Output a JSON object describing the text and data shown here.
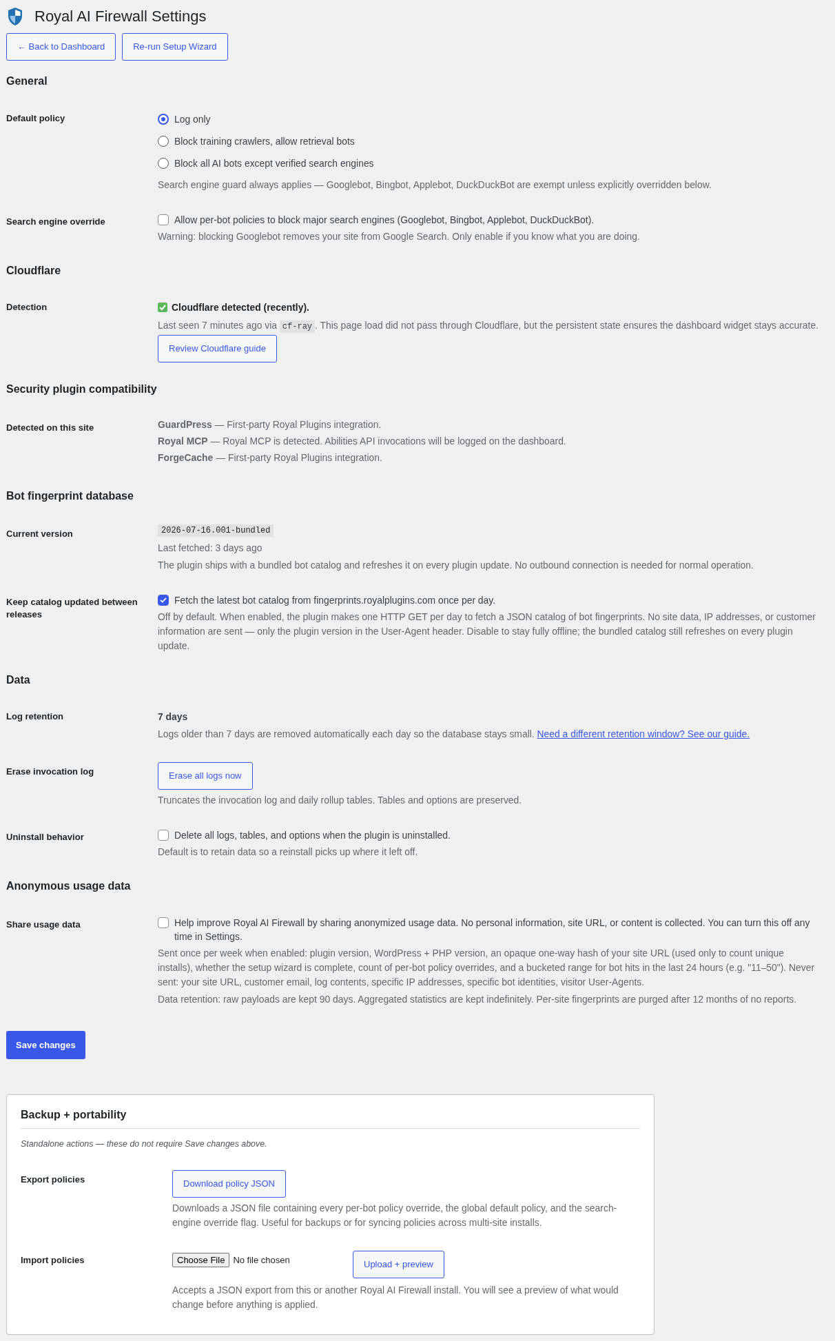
{
  "header": {
    "title": "Royal AI Firewall Settings",
    "buttons": [
      "← Back to Dashboard",
      "Re-run Setup Wizard"
    ]
  },
  "sections": [
    {
      "heading": "General",
      "rows": [
        {
          "kind": "radios",
          "label": "Default policy",
          "options": [
            {
              "label": "Log only",
              "selected": true
            },
            {
              "label": "Block training crawlers, allow retrieval bots",
              "selected": false
            },
            {
              "label": "Block all AI bots except verified search engines",
              "selected": false
            }
          ],
          "notes": [
            "Search engine guard always applies — Googlebot, Bingbot, Applebot, DuckDuckBot are exempt unless explicitly overridden below."
          ]
        },
        {
          "kind": "checkbox",
          "label": "Search engine override",
          "checkbox": {
            "label": "Allow per-bot policies to block major search engines (Googlebot, Bingbot, Applebot, DuckDuckBot).",
            "checked": false
          },
          "notes": [
            "Warning: blocking Googlebot removes your site from Google Search. Only enable if you know what you are doing."
          ]
        }
      ]
    },
    {
      "heading": "Cloudflare",
      "rows": [
        {
          "kind": "status",
          "label": "Detection",
          "status": {
            "text": "Cloudflare detected (recently).",
            "ok": true
          },
          "detail": {
            "before": "Last seen 7 minutes ago via",
            "code": "cf-ray",
            "after": ". This page load did not pass through Cloudflare, but the persistent state ensures the dashboard widget stays accurate."
          },
          "button": "Review Cloudflare guide"
        }
      ]
    },
    {
      "heading": "Security plugin compatibility",
      "rows": [
        {
          "kind": "list",
          "label": "Detected on this site",
          "items": [
            "**GuardPress** — First-party Royal Plugins integration.",
            "**Royal MCP** — Royal MCP is detected. Abilities API invocations will be logged on the dashboard.",
            "**ForgeCache** — First-party Royal Plugins integration."
          ]
        }
      ]
    },
    {
      "heading": "Bot fingerprint database",
      "rows": [
        {
          "kind": "version",
          "label": "Current version",
          "code": "2026-07-16.001-bundled",
          "notes": [
            "Last fetched: 3 days ago",
            "The plugin ships with a bundled bot catalog and refreshes it on every plugin update. No outbound connection is needed for normal operation."
          ]
        },
        {
          "kind": "checkbox",
          "label": "Keep catalog updated between releases",
          "checkbox": {
            "label": "Fetch the latest bot catalog from fingerprints.royalplugins.com once per day.",
            "checked": true
          },
          "notes": [
            "Off by default. When enabled, the plugin makes one HTTP GET per day to fetch a JSON catalog of bot fingerprints. No site data, IP addresses, or customer information are sent — only the plugin version in the User-Agent header. Disable to stay fully offline; the bundled catalog still refreshes on every plugin update."
          ]
        }
      ]
    },
    {
      "heading": "Data",
      "rows": [
        {
          "kind": "value",
          "label": "Log retention",
          "value": "7 days",
          "notes": [
            "Logs older than 7 days are removed automatically each day so the database stays small."
          ],
          "link": "Need a different retention window? See our guide."
        },
        {
          "kind": "button",
          "label": "Erase invocation log",
          "button": "Erase all logs now",
          "notes": [
            "Truncates the invocation log and daily rollup tables. Tables and options are preserved."
          ]
        },
        {
          "kind": "checkbox",
          "label": "Uninstall behavior",
          "checkbox": {
            "label": "Delete all logs, tables, and options when the plugin is uninstalled.",
            "checked": false
          },
          "notes": [
            "Default is to retain data so a reinstall picks up where it left off."
          ]
        }
      ]
    },
    {
      "heading": "Anonymous usage data",
      "rows": [
        {
          "kind": "checkbox",
          "label": "Share usage data",
          "checkbox": {
            "label": "Help improve Royal AI Firewall by sharing anonymized usage data. No personal information, site URL, or content is collected. You can turn this off any time in Settings.",
            "checked": false
          },
          "notes": [
            "Sent once per week when enabled: plugin version, WordPress + PHP version, an opaque one-way hash of your site URL (used only to count unique installs), whether the setup wizard is complete, count of per-bot policy overrides, and a bucketed range for bot hits in the last 24 hours (e.g. \"11–50\"). Never sent: your site URL, customer email, log contents, specific IP addresses, specific bot identities, visitor User-Agents.",
            "Data retention: raw payloads are kept 90 days. Aggregated statistics are kept indefinitely. Per-site fingerprints are purged after 12 months of no reports."
          ]
        }
      ]
    }
  ],
  "save_button": "Save changes",
  "backup": {
    "title": "Backup + portability",
    "note": "Standalone actions — these do not require Save changes above.",
    "rows": [
      {
        "kind": "button",
        "label": "Export policies",
        "button": "Download policy JSON",
        "notes": [
          "Downloads a JSON file containing every per-bot policy override, the global default policy, and the search-engine override flag. Useful for backups or for syncing policies across multi-site installs."
        ]
      },
      {
        "kind": "file",
        "label": "Import policies",
        "file_button": "Choose File",
        "file_status": "No file chosen",
        "button": "Upload + preview",
        "notes": [
          "Accepts a JSON export from this or another Royal AI Firewall install. You will see a preview of what would change before anything is applied."
        ]
      }
    ]
  }
}
